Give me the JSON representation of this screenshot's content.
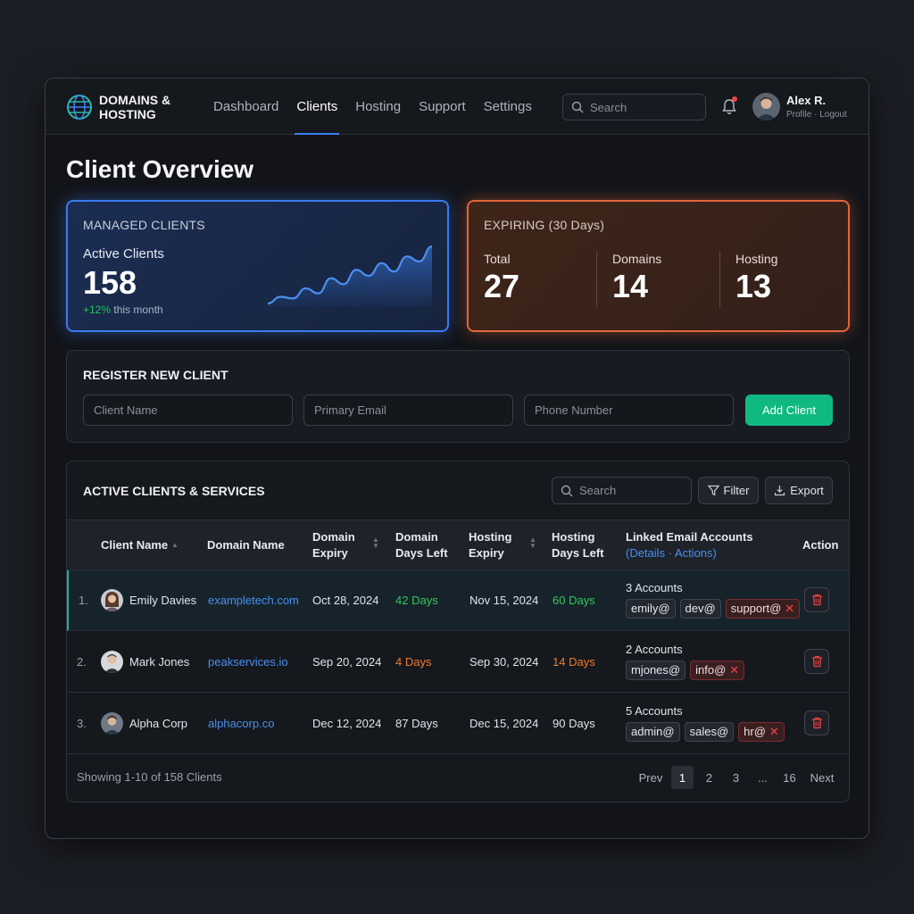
{
  "brand": {
    "name": "DOMAINS & HOSTING"
  },
  "nav": {
    "items": [
      {
        "label": "Dashboard"
      },
      {
        "label": "Clients"
      },
      {
        "label": "Hosting"
      },
      {
        "label": "Support"
      },
      {
        "label": "Settings"
      }
    ],
    "active": "Clients",
    "search_placeholder": "Search"
  },
  "user": {
    "name": "Alex R.",
    "links": "Profile · Logout"
  },
  "page": {
    "title": "Client Overview"
  },
  "managed": {
    "heading": "MANAGED CLIENTS",
    "label": "Active Clients",
    "value": "158",
    "change": "+12%",
    "change_suffix": " this month",
    "trend": [
      22,
      30,
      28,
      40,
      34,
      52,
      45,
      62,
      55,
      70,
      60,
      78,
      72,
      90
    ]
  },
  "expiring": {
    "heading": "EXPIRING (30 Days)",
    "stats": [
      {
        "label": "Total",
        "value": "27"
      },
      {
        "label": "Domains",
        "value": "14"
      },
      {
        "label": "Hosting",
        "value": "13"
      }
    ]
  },
  "register": {
    "heading": "REGISTER NEW CLIENT",
    "name_placeholder": "Client Name",
    "email_placeholder": "Primary Email",
    "phone_placeholder": "Phone Number",
    "button": "Add Client"
  },
  "table": {
    "heading": "ACTIVE CLIENTS & SERVICES",
    "search_placeholder": "Search",
    "filter_label": "Filter",
    "export_label": "Export",
    "columns": {
      "client": "Client Name",
      "domain": "Domain Name",
      "domain_expiry_1": "Domain",
      "domain_expiry_2": "Expiry",
      "domain_days_1": "Domain",
      "domain_days_2": "Days Left",
      "hosting_expiry_1": "Hosting",
      "hosting_expiry_2": "Expiry",
      "hosting_days_1": "Hosting",
      "hosting_days_2": "Days Left",
      "emails_1": "Linked Email Accounts",
      "emails_2": "(Details · Actions)",
      "action": "Action"
    },
    "rows": [
      {
        "num": "1.",
        "name": "Emily Davies",
        "domain": "exampletech.com",
        "domain_expiry": "Oct 28, 2024",
        "domain_days": "42 Days",
        "hosting_expiry": "Nov 15, 2024",
        "hosting_days": "60 Days",
        "accounts": "3 Accounts",
        "emails": [
          {
            "label": "emily@"
          },
          {
            "label": "dev@"
          },
          {
            "label": "support@",
            "warn": true
          }
        ]
      },
      {
        "num": "2.",
        "name": "Mark Jones",
        "domain": "peakservices.io",
        "domain_expiry": "Sep 20, 2024",
        "domain_days": "4 Days",
        "hosting_expiry": "Sep 30, 2024",
        "hosting_days": "14 Days",
        "accounts": "2 Accounts",
        "emails": [
          {
            "label": "mjones@"
          },
          {
            "label": "info@",
            "warn": true
          }
        ]
      },
      {
        "num": "3.",
        "name": "Alpha Corp",
        "domain": "alphacorp.co",
        "domain_expiry": "Dec 12, 2024",
        "domain_days": "87 Days",
        "hosting_expiry": "Dec 15, 2024",
        "hosting_days": "90 Days",
        "accounts": "5 Accounts",
        "emails": [
          {
            "label": "admin@"
          },
          {
            "label": "sales@"
          },
          {
            "label": "hr@",
            "warn": true
          }
        ]
      }
    ],
    "footer": "Showing 1-10 of 158 Clients",
    "pagination": {
      "prev": "Prev",
      "pages": [
        "1",
        "2",
        "3",
        "...",
        "16"
      ],
      "current": "1",
      "next": "Next"
    }
  },
  "colors": {
    "accent": "#3b82f6",
    "success": "#10b981",
    "warning": "#f07a32",
    "danger": "#ef4444"
  }
}
